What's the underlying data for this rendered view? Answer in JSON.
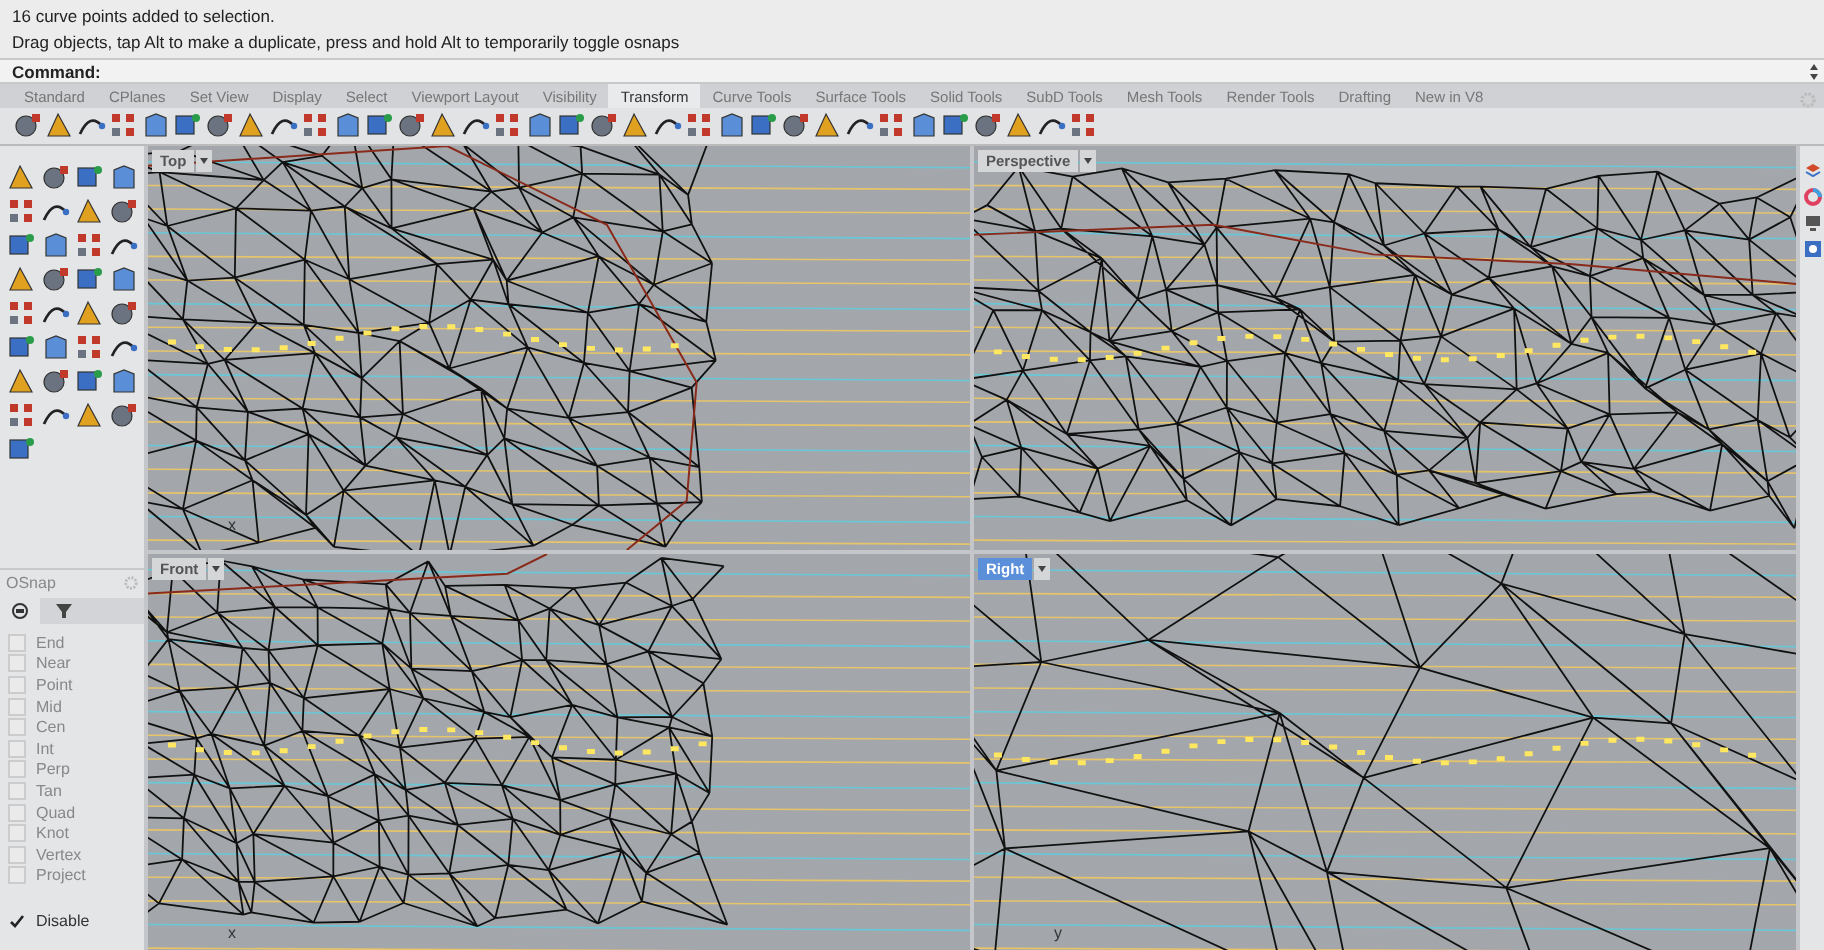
{
  "history": [
    "16 curve points added to selection.",
    "Drag objects, tap Alt to make a duplicate, press and hold Alt to temporarily toggle osnaps"
  ],
  "command": {
    "label": "Command:"
  },
  "toolbar_tabs": [
    {
      "label": "Standard",
      "selected": false
    },
    {
      "label": "CPlanes",
      "selected": false
    },
    {
      "label": "Set View",
      "selected": false
    },
    {
      "label": "Display",
      "selected": false
    },
    {
      "label": "Select",
      "selected": false
    },
    {
      "label": "Viewport Layout",
      "selected": false
    },
    {
      "label": "Visibility",
      "selected": false
    },
    {
      "label": "Transform",
      "selected": true
    },
    {
      "label": "Curve Tools",
      "selected": false
    },
    {
      "label": "Surface Tools",
      "selected": false
    },
    {
      "label": "Solid Tools",
      "selected": false
    },
    {
      "label": "SubD Tools",
      "selected": false
    },
    {
      "label": "Mesh Tools",
      "selected": false
    },
    {
      "label": "Render Tools",
      "selected": false
    },
    {
      "label": "Drafting",
      "selected": false
    },
    {
      "label": "New in V8",
      "selected": false
    }
  ],
  "viewports": [
    {
      "title": "Top",
      "selected": false,
      "axis_label": "x"
    },
    {
      "title": "Perspective",
      "selected": false
    },
    {
      "title": "Front",
      "selected": false,
      "axis_label": "x"
    },
    {
      "title": "Right",
      "selected": true,
      "axis_label": "y"
    }
  ],
  "osnap": {
    "title": "OSnap",
    "items": [
      {
        "label": "End",
        "checked": false
      },
      {
        "label": "Near",
        "checked": false
      },
      {
        "label": "Point",
        "checked": false
      },
      {
        "label": "Mid",
        "checked": false
      },
      {
        "label": "Cen",
        "checked": false
      },
      {
        "label": "Int",
        "checked": false
      },
      {
        "label": "Perp",
        "checked": false
      },
      {
        "label": "Tan",
        "checked": false
      },
      {
        "label": "Quad",
        "checked": false
      },
      {
        "label": "Knot",
        "checked": false
      },
      {
        "label": "Vertex",
        "checked": false
      },
      {
        "label": "Project",
        "checked": false
      }
    ],
    "disable": {
      "label": "Disable",
      "checked": true
    }
  }
}
